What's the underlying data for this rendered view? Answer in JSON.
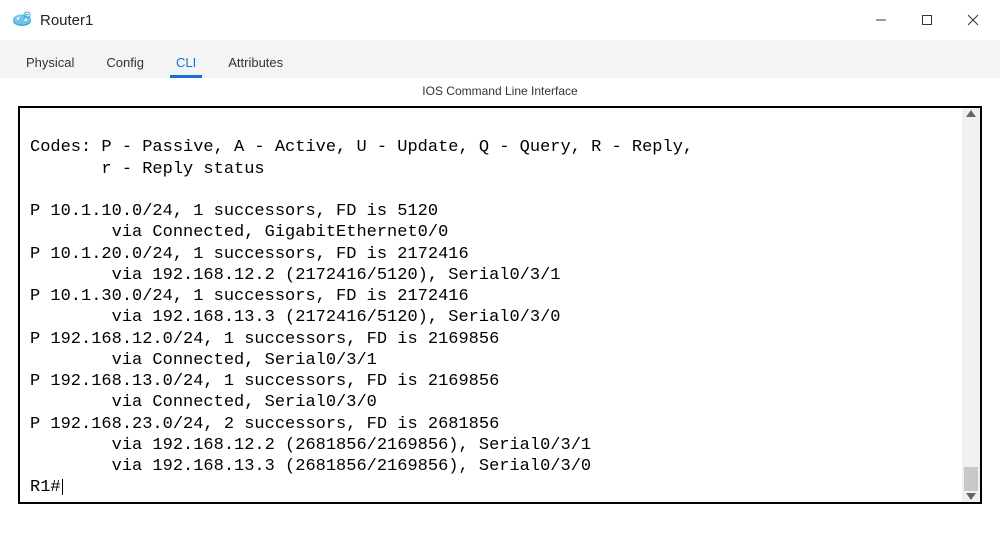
{
  "window": {
    "title": "Router1"
  },
  "tabs": {
    "items": [
      {
        "label": "Physical"
      },
      {
        "label": "Config"
      },
      {
        "label": "CLI"
      },
      {
        "label": "Attributes"
      }
    ],
    "active_index": 2
  },
  "cli": {
    "header": "IOS Command Line Interface",
    "codes_line1": "Codes: P - Passive, A - Active, U - Update, Q - Query, R - Reply,",
    "codes_line2": "       r - Reply status",
    "routes": [
      {
        "head": "P 10.1.10.0/24, 1 successors, FD is 5120",
        "vias": [
          "        via Connected, GigabitEthernet0/0"
        ]
      },
      {
        "head": "P 10.1.20.0/24, 1 successors, FD is 2172416",
        "vias": [
          "        via 192.168.12.2 (2172416/5120), Serial0/3/1"
        ]
      },
      {
        "head": "P 10.1.30.0/24, 1 successors, FD is 2172416",
        "vias": [
          "        via 192.168.13.3 (2172416/5120), Serial0/3/0"
        ]
      },
      {
        "head": "P 192.168.12.0/24, 1 successors, FD is 2169856",
        "vias": [
          "        via Connected, Serial0/3/1"
        ]
      },
      {
        "head": "P 192.168.13.0/24, 1 successors, FD is 2169856",
        "vias": [
          "        via Connected, Serial0/3/0"
        ]
      },
      {
        "head": "P 192.168.23.0/24, 2 successors, FD is 2681856",
        "vias": [
          "        via 192.168.12.2 (2681856/2169856), Serial0/3/1",
          "        via 192.168.13.3 (2681856/2169856), Serial0/3/0"
        ]
      }
    ],
    "prompt": "R1#"
  }
}
